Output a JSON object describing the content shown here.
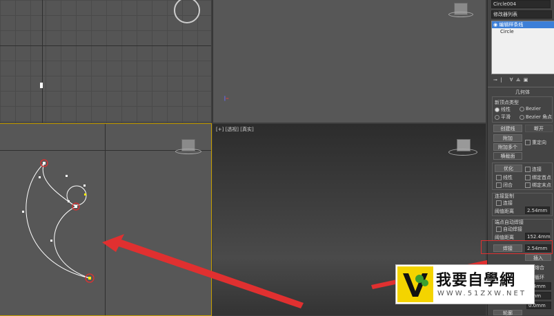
{
  "modifier_panel": {
    "object_name": "Circle004",
    "modifier_list_label": "修改器列表",
    "stack": [
      {
        "label": "编辑样条线",
        "selected": true
      },
      {
        "label": "Circle",
        "selected": false
      }
    ],
    "rollout_title": "几何体",
    "new_vertex_type": {
      "label": "新顶点类型",
      "options": [
        {
          "label": "线性",
          "selected": true
        },
        {
          "label": "Bezier",
          "selected": false
        },
        {
          "label": "平滑",
          "selected": false
        },
        {
          "label": "Bezier 角点",
          "selected": false
        }
      ]
    },
    "buttons": {
      "create_line": "创建线",
      "break": "断开",
      "attach": "附加",
      "reorient": "重定向",
      "attach_multiple": "附加多个",
      "cross_section": "横截面",
      "refine": "优化",
      "connect": "连接",
      "insert": "插入"
    },
    "refine_options": {
      "linear": "线性",
      "bind_first": "绑定首点",
      "closed": "闭合",
      "bind_last": "绑定末点"
    },
    "connect_copy": {
      "label": "连接复制",
      "connect": "连接",
      "threshold_label": "阈值距离",
      "threshold_value": "2.54mm"
    },
    "end_point_weld": {
      "label": "端点自动焊接",
      "auto_weld": "自动焊接",
      "threshold_label": "阈值距离",
      "threshold_value": "152.4mm"
    },
    "weld": {
      "label": "焊接",
      "value": "2.54mm"
    },
    "fuse": "熔合",
    "cycle": "循环",
    "values_lower": [
      "3.4mm",
      "0mm",
      "0.0mm"
    ],
    "fillet_label": "轮廓"
  },
  "viewports": {
    "perspective_label": "[+] [透视] [真实]"
  },
  "watermark": {
    "title": "我要自學網",
    "url": "WWW.51ZXW.NET"
  },
  "colors": {
    "highlight": "#e03030",
    "selection": "#3c7fd8",
    "active_viewport": "#c8a000"
  }
}
